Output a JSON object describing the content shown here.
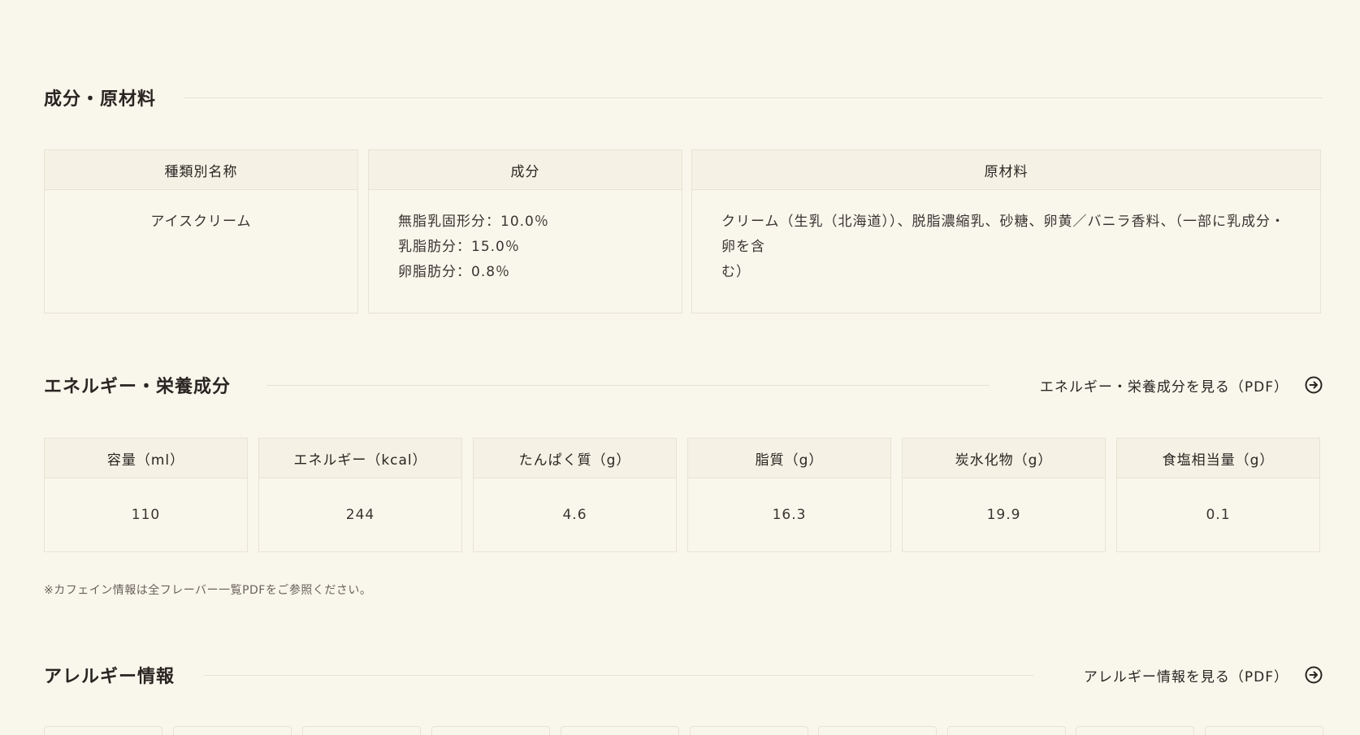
{
  "ingredients": {
    "title": "成分・原材料",
    "columns": [
      {
        "header": "種類別名称",
        "lines": [
          "アイスクリーム"
        ]
      },
      {
        "header": "成分",
        "lines": [
          "無脂乳固形分：10.0％",
          "乳脂肪分：15.0％",
          "卵脂肪分：0.8％"
        ]
      },
      {
        "header": "原材料",
        "lines": [
          "クリーム（生乳（北海道））、脱脂濃縮乳、砂糖、卵黄／バニラ香料、（一部に乳成分・卵を含",
          "む）"
        ]
      }
    ]
  },
  "nutrition": {
    "title": "エネルギー・栄養成分",
    "pdf_link": "エネルギー・栄養成分を見る（PDF）",
    "columns": [
      {
        "header": "容量（ml）",
        "value": "110"
      },
      {
        "header": "エネルギー（kcal）",
        "value": "244"
      },
      {
        "header": "たんぱく質（g）",
        "value": "4.6"
      },
      {
        "header": "脂質（g）",
        "value": "16.3"
      },
      {
        "header": "炭水化物（g）",
        "value": "19.9"
      },
      {
        "header": "食塩相当量（g）",
        "value": "0.1"
      }
    ],
    "note": "※カフェイン情報は全フレーバー一覧PDFをご参照ください。"
  },
  "allergy": {
    "title": "アレルギー情報",
    "pdf_link": "アレルギー情報を見る（PDF）"
  },
  "icons": {
    "pdf_link": "circle-arrow-right-icon"
  },
  "colors": {
    "background": "#f9f7ec",
    "header_bg": "#f5f2e5",
    "border": "#e7e3d4",
    "text": "#2a2522"
  }
}
